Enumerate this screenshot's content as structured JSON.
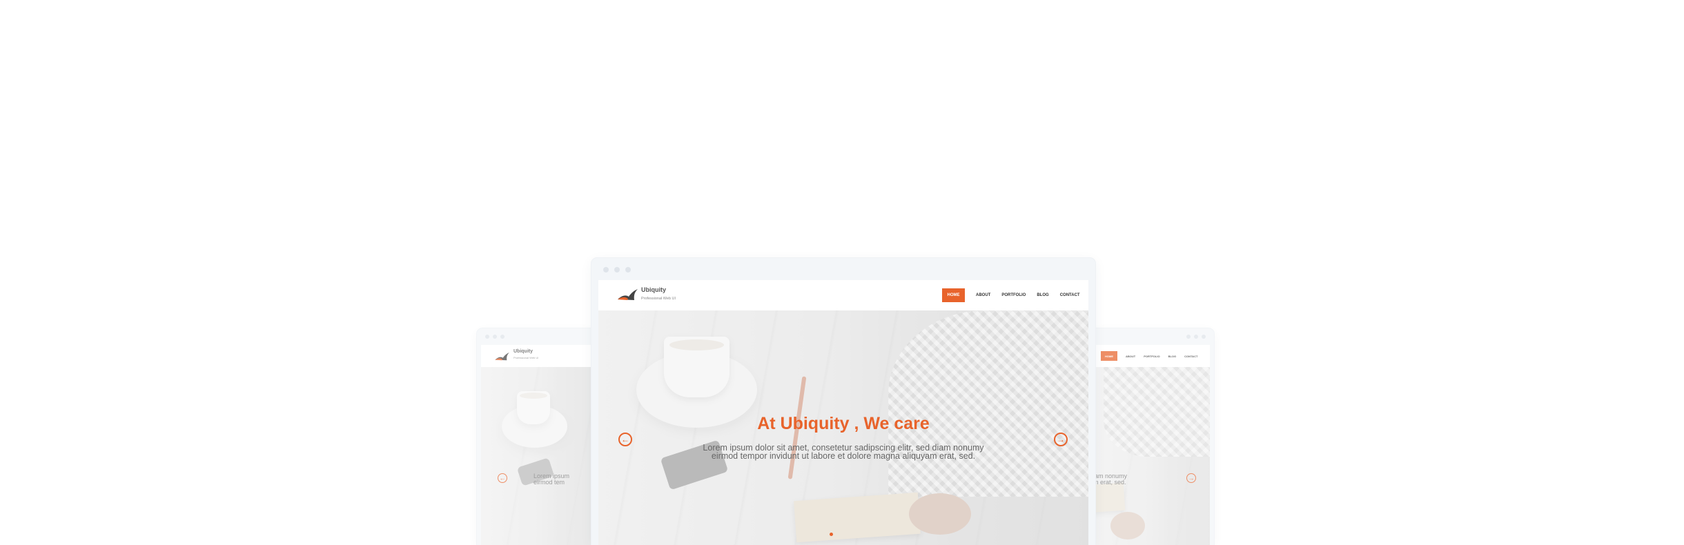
{
  "site": {
    "brand": "Ubiquity",
    "tagline": "Professional Web UI",
    "nav": [
      "HOME",
      "ABOUT",
      "PORTFOLIO",
      "BLOG",
      "CONTACT"
    ],
    "active_nav": "HOME"
  },
  "hero": {
    "title": "At Ubiquity , We care",
    "text": "Lorem ipsum dolor sit amet, consetetur sadipscing elitr, sed diam nonumy\neirmod tempor invidunt ut labore et dolore magna aliquyam erat, sed.",
    "left_partial_text": "Lorem ipsum\neirmod tem",
    "right_partial_text": "diam nonumy\nam erat, sed.",
    "prev_icon": "arrow-left-icon",
    "next_icon": "arrow-right-icon"
  },
  "colors": {
    "accent": "#e8632b",
    "chrome": "#f3f6f9",
    "text": "#666666"
  }
}
